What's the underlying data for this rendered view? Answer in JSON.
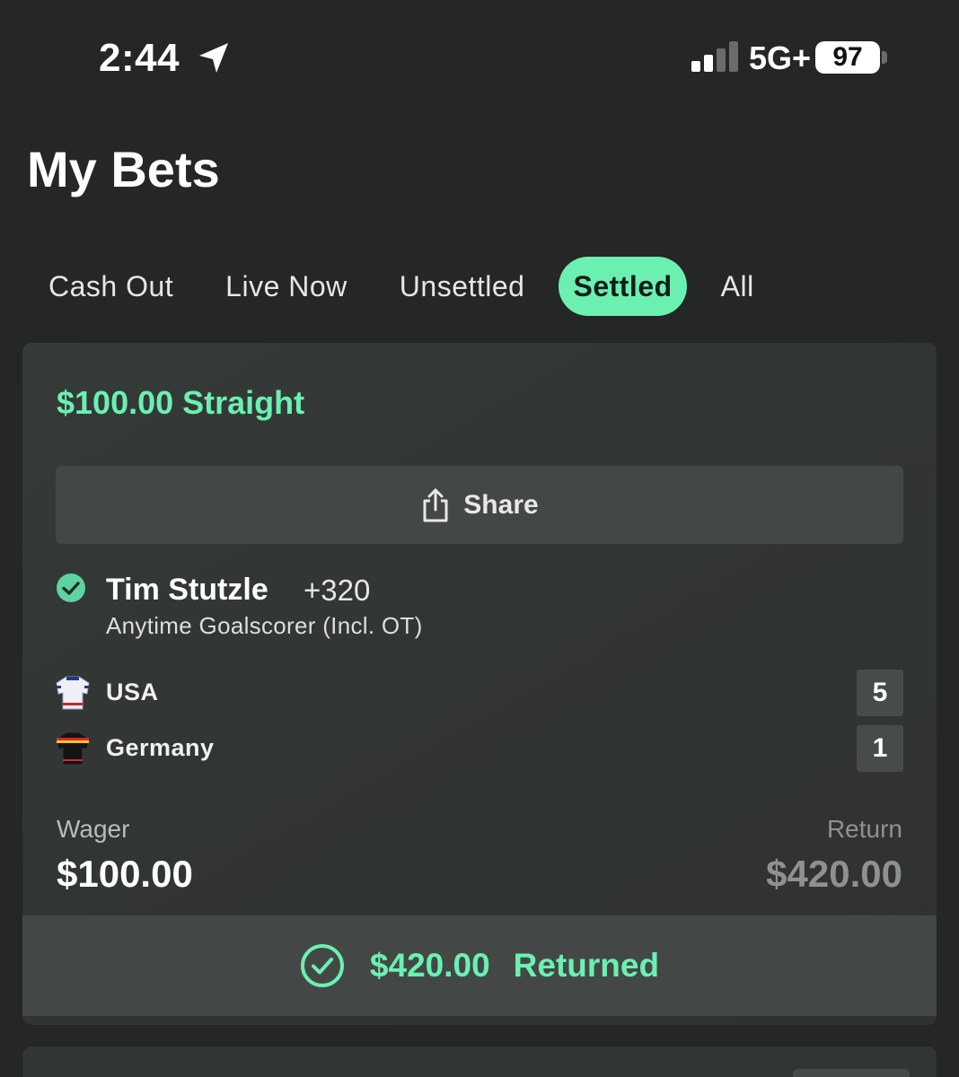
{
  "status_bar": {
    "time": "2:44",
    "network": "5G+",
    "battery": "97",
    "icons": [
      "location-arrow-icon",
      "signal-bars-icon",
      "battery-icon"
    ]
  },
  "page": {
    "title": "My Bets"
  },
  "tabs": [
    {
      "label": "Cash Out",
      "active": false
    },
    {
      "label": "Live Now",
      "active": false
    },
    {
      "label": "Unsettled",
      "active": false
    },
    {
      "label": "Settled",
      "active": true
    },
    {
      "label": "All",
      "active": false
    }
  ],
  "bet": {
    "title": "$100.00 Straight",
    "share_label": "Share",
    "selection": "Tim Stutzle",
    "odds": "+320",
    "market": "Anytime Goalscorer (Incl. OT)",
    "teams": [
      {
        "name": "USA",
        "score": "5",
        "icon": "usa-jersey-icon"
      },
      {
        "name": "Germany",
        "score": "1",
        "icon": "germany-jersey-icon"
      }
    ],
    "wager_label": "Wager",
    "wager_value": "$100.00",
    "return_label": "Return",
    "return_value": "$420.00",
    "returned_amount": "$420.00",
    "returned_label": "Returned"
  },
  "colors": {
    "accent": "#6bf0b2",
    "background": "#252626",
    "card": "#333836",
    "button": "#434846",
    "muted": "#8d9190"
  }
}
